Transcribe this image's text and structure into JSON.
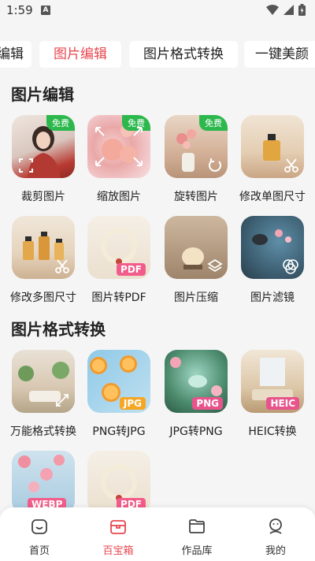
{
  "status": {
    "time": "1:59",
    "notif_letter": "A"
  },
  "tabs": [
    {
      "label": "图片编辑",
      "active": false
    },
    {
      "label": "图片编辑",
      "active": true
    },
    {
      "label": "图片格式转换",
      "active": false
    },
    {
      "label": "一键美颜",
      "active": false
    }
  ],
  "section1": {
    "title": "图片编辑",
    "tiles": [
      {
        "label": "裁剪图片",
        "badge": "免费",
        "icon": "crop-icon"
      },
      {
        "label": "缩放图片",
        "badge": "免费",
        "icon": "expand-icon"
      },
      {
        "label": "旋转图片",
        "badge": "免费",
        "icon": "rotate-icon"
      },
      {
        "label": "修改单图尺寸",
        "icon": "scissors-icon"
      },
      {
        "label": "修改多图尺寸",
        "icon": "scissors-icon"
      },
      {
        "label": "图片转PDF",
        "format": "PDF"
      },
      {
        "label": "图片压缩",
        "icon": "layers-icon"
      },
      {
        "label": "图片滤镜",
        "icon": "filter-icon"
      }
    ]
  },
  "section2": {
    "title": "图片格式转换",
    "tiles": [
      {
        "label": "万能格式转换",
        "icon": "transform-icon"
      },
      {
        "label": "PNG转JPG",
        "format": "JPG"
      },
      {
        "label": "JPG转PNG",
        "format": "PNG"
      },
      {
        "label": "HEIC转换",
        "format": "HEIC"
      },
      {
        "label": "",
        "format": "WEBP"
      },
      {
        "label": "",
        "format": "PDF"
      }
    ]
  },
  "nav": [
    {
      "label": "首页",
      "icon": "home-icon",
      "active": false
    },
    {
      "label": "百宝箱",
      "icon": "toolbox-icon",
      "active": true
    },
    {
      "label": "作品库",
      "icon": "folder-icon",
      "active": false
    },
    {
      "label": "我的",
      "icon": "profile-icon",
      "active": false
    }
  ],
  "colors": {
    "accent": "#e8474f",
    "free_badge": "#2db84d",
    "pdf_badge": "#f25c8a",
    "jpg_badge": "#f5a623",
    "png_badge": "#e8538b",
    "heic_badge": "#e8538b",
    "webp_badge": "#f25c8a"
  }
}
